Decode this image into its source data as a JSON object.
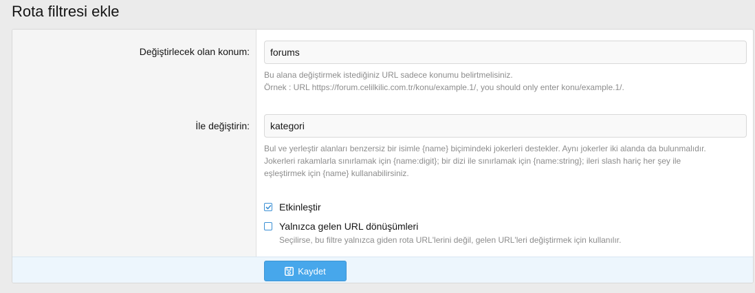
{
  "page": {
    "title": "Rota filtresi ekle"
  },
  "form": {
    "find_route": {
      "label": "Değiştirlecek olan konum:",
      "value": "forums",
      "explain_line1": "Bu alana değiştirmek istediğiniz URL sadece konumu belirtmelisiniz.",
      "explain_line2": "Örnek : URL https://forum.celilkilic.com.tr/konu/example.1/, you should only enter konu/example.1/."
    },
    "replace_route": {
      "label": "İle değiştirin:",
      "value": "kategori",
      "explain_line1": "Bul ve yerleştir alanları benzersiz bir isimle {name} biçimindeki jokerleri destekler. Aynı jokerler iki alanda da bulunmalıdır.",
      "explain_line2": "Jokerleri rakamlarla sınırlamak için {name:digit}; bir dizi ile sınırlamak için {name:string}; ileri slash hariç her şey ile",
      "explain_line3": "eşleştirmek için {name} kullanabilirsiniz."
    },
    "options": [
      {
        "label": "Etkinleştir",
        "checked": true
      },
      {
        "label": "Yalnızca gelen URL dönüşümleri",
        "checked": false,
        "hint": "Seçilirse, bu filtre yalnızca giden rota URL'lerini değil, gelen URL'leri değiştirmek için kullanılır."
      }
    ],
    "submit": {
      "label": "Kaydet",
      "icon": "save-icon"
    }
  },
  "colors": {
    "accent": "#47a7eb",
    "checkbox": "#3a8fd4"
  }
}
